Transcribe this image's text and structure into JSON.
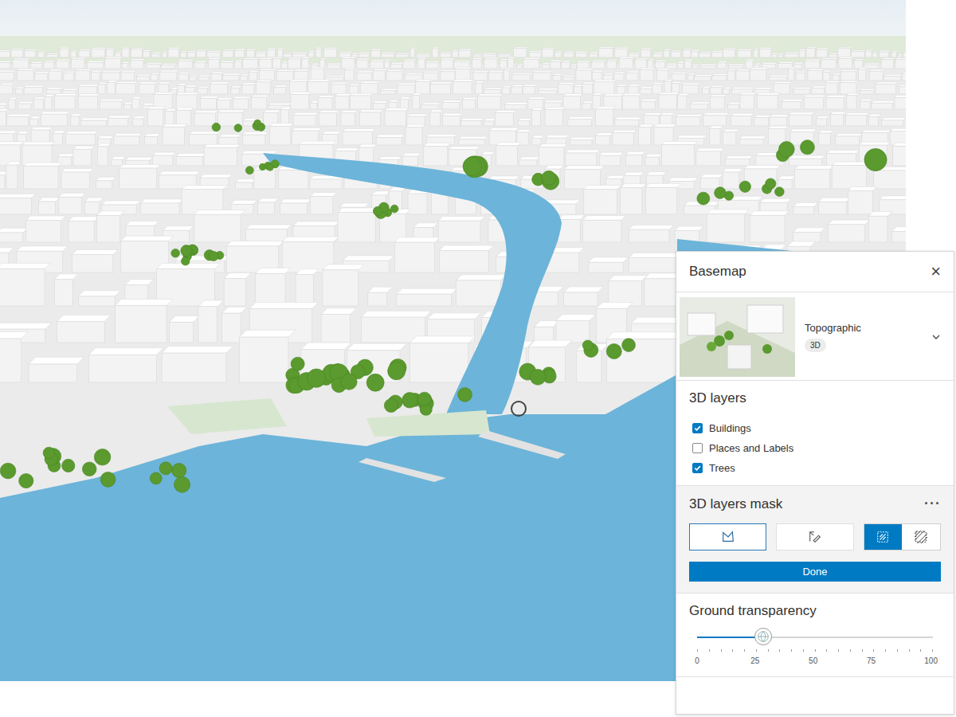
{
  "panel": {
    "title": "Basemap",
    "close": "×"
  },
  "basemap": {
    "name": "Topographic",
    "badge": "3D",
    "expanded": false
  },
  "layers": {
    "title": "3D layers",
    "items": [
      {
        "label": "Buildings",
        "checked": true
      },
      {
        "label": "Places and Labels",
        "checked": false
      },
      {
        "label": "Trees",
        "checked": true
      }
    ]
  },
  "mask": {
    "title": "3D layers mask",
    "more": "···",
    "tools": [
      {
        "kind": "polygon",
        "selected": true
      },
      {
        "kind": "sketch",
        "selected": false
      }
    ],
    "modes": [
      {
        "kind": "inside",
        "selected": true
      },
      {
        "kind": "outside",
        "selected": false
      }
    ],
    "done": "Done"
  },
  "transparency": {
    "title": "Ground transparency",
    "level": 0.28,
    "ticks": [
      "0",
      "25",
      "50",
      "75",
      "100"
    ]
  }
}
